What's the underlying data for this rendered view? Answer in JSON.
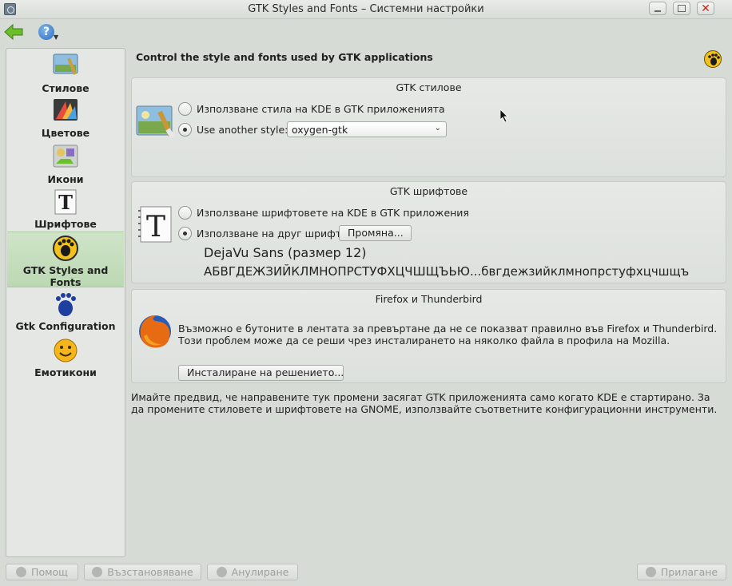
{
  "window": {
    "title": "GTK Styles and Fonts – Системни настройки"
  },
  "sidebar": {
    "items": [
      {
        "label": "Стилове",
        "icon": "styles-icon"
      },
      {
        "label": "Цветове",
        "icon": "colors-icon"
      },
      {
        "label": "Икони",
        "icon": "icons-icon"
      },
      {
        "label": "Шрифтове",
        "icon": "fonts-icon"
      },
      {
        "label": "GTK Styles and Fonts",
        "icon": "gtk-icon",
        "selected": true
      },
      {
        "label": "Gtk Configuration",
        "icon": "gnome-foot-icon"
      },
      {
        "label": "Емотикони",
        "icon": "smiley-icon"
      }
    ]
  },
  "main": {
    "heading": "Control the style and fonts used by GTK applications",
    "styles": {
      "title": "GTK стилове",
      "option_kde": "Използване стила на KDE в GTK приложенията",
      "option_other": "Use another style:",
      "selected_option": "option_other",
      "combo_value": "oxygen-gtk"
    },
    "fonts": {
      "title": "GTK шрифтове",
      "option_kde": "Използване шрифтовете на KDE в GTK приложения",
      "option_other": "Използване на друг шрифт:",
      "selected_option": "option_other",
      "change_button": "Промяна...",
      "preview_name": "DejaVu Sans (размер 12)",
      "preview_sample": "АБВГДЕЖЗИЙКЛМНОПРСТУФХЦЧШЩЪЬЮ...бвгдежзийклмнопрстуфхцчшщъ"
    },
    "firefox": {
      "title": "Firefox и Thunderbird",
      "text": "Възможно е бутоните в лентата за превъртане да не се показват правилно във Firefox и Thunderbird.  Този проблем може да се реши чрез инсталирането на няколко файла в профила на Mozilla.",
      "install_button": "Инсталиране на решението..."
    },
    "note": "Имайте предвид, че направените тук промени засягат GTK приложенията само когато KDE е стартирано. За да промените стиловете и шрифтовете на GNOME, използвайте съответните конфигурационни инструменти."
  },
  "footer": {
    "help": "Помощ",
    "reset": "Възстановяване",
    "cancel": "Анулиране",
    "apply": "Прилагане"
  },
  "colors": {
    "selected_bg": "#c4dcbc",
    "window_bg": "#d6dbd6"
  }
}
